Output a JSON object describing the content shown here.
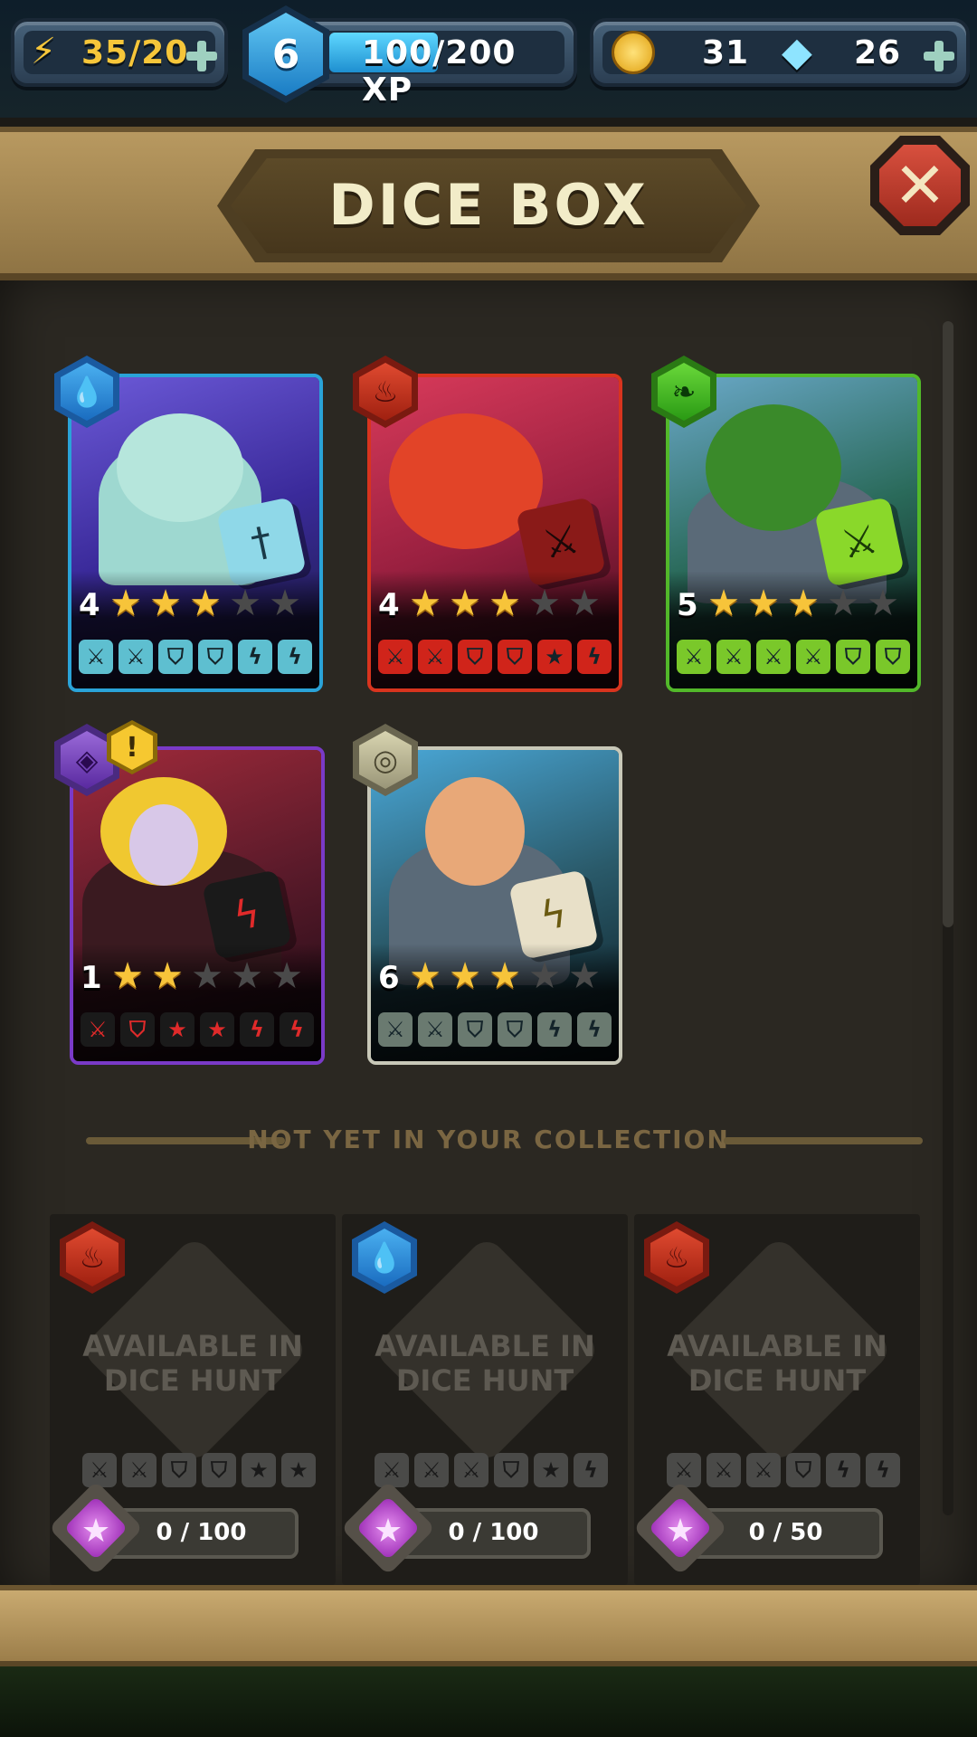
{
  "topbar": {
    "energy": "35/20",
    "player_level": "6",
    "xp": "100/200 XP",
    "xp_progress": 0.5,
    "coins": "31",
    "gems": "26"
  },
  "header": {
    "title": "DICE BOX"
  },
  "collection": [
    {
      "element": "water-icon",
      "level": "4",
      "stars": 3,
      "max_stars": 5,
      "border_color": "#2aa3d8",
      "faces": [
        "sword",
        "sword",
        "shield",
        "shield",
        "bolt",
        "bolt"
      ],
      "face_color": "#5ebfd0"
    },
    {
      "element": "fire-icon",
      "level": "4",
      "stars": 3,
      "max_stars": 5,
      "border_color": "#d8341e",
      "faces": [
        "sword",
        "sword",
        "shield",
        "shield",
        "star",
        "bolt"
      ],
      "face_color": "#d0241a"
    },
    {
      "element": "leaf-icon",
      "level": "5",
      "stars": 3,
      "max_stars": 5,
      "border_color": "#52b82a",
      "faces": [
        "sword",
        "sword",
        "sword",
        "sword",
        "shield",
        "shield"
      ],
      "face_color": "#7ac82a"
    },
    {
      "element": "dark-icon",
      "level": "1",
      "stars": 2,
      "max_stars": 5,
      "border_color": "#7a3ac8",
      "faces": [
        "sword",
        "shield",
        "star",
        "star",
        "bolt",
        "bolt"
      ],
      "face_color": "#1a1a1a",
      "alert": "!"
    },
    {
      "element": "wind-icon",
      "level": "6",
      "stars": 3,
      "max_stars": 5,
      "border_color": "#c8c8b8",
      "faces": [
        "sword",
        "sword",
        "shield",
        "shield",
        "bolt",
        "bolt"
      ],
      "face_color": "#6a7a70"
    }
  ],
  "section_divider": "NOT YET IN YOUR COLLECTION",
  "not_collected": [
    {
      "element": "fire-icon",
      "availability": "AVAILABLE IN DICE HUNT",
      "faces": [
        "sword",
        "sword",
        "shield",
        "shield",
        "star",
        "star"
      ],
      "progress": "0 / 100"
    },
    {
      "element": "water-icon",
      "availability": "AVAILABLE IN DICE HUNT",
      "faces": [
        "sword",
        "sword",
        "sword",
        "shield",
        "star",
        "bolt"
      ],
      "progress": "0 / 100"
    },
    {
      "element": "fire-icon",
      "availability": "AVAILABLE IN DICE HUNT",
      "faces": [
        "sword",
        "sword",
        "sword",
        "shield",
        "bolt",
        "bolt"
      ],
      "progress": "0 / 50"
    }
  ]
}
